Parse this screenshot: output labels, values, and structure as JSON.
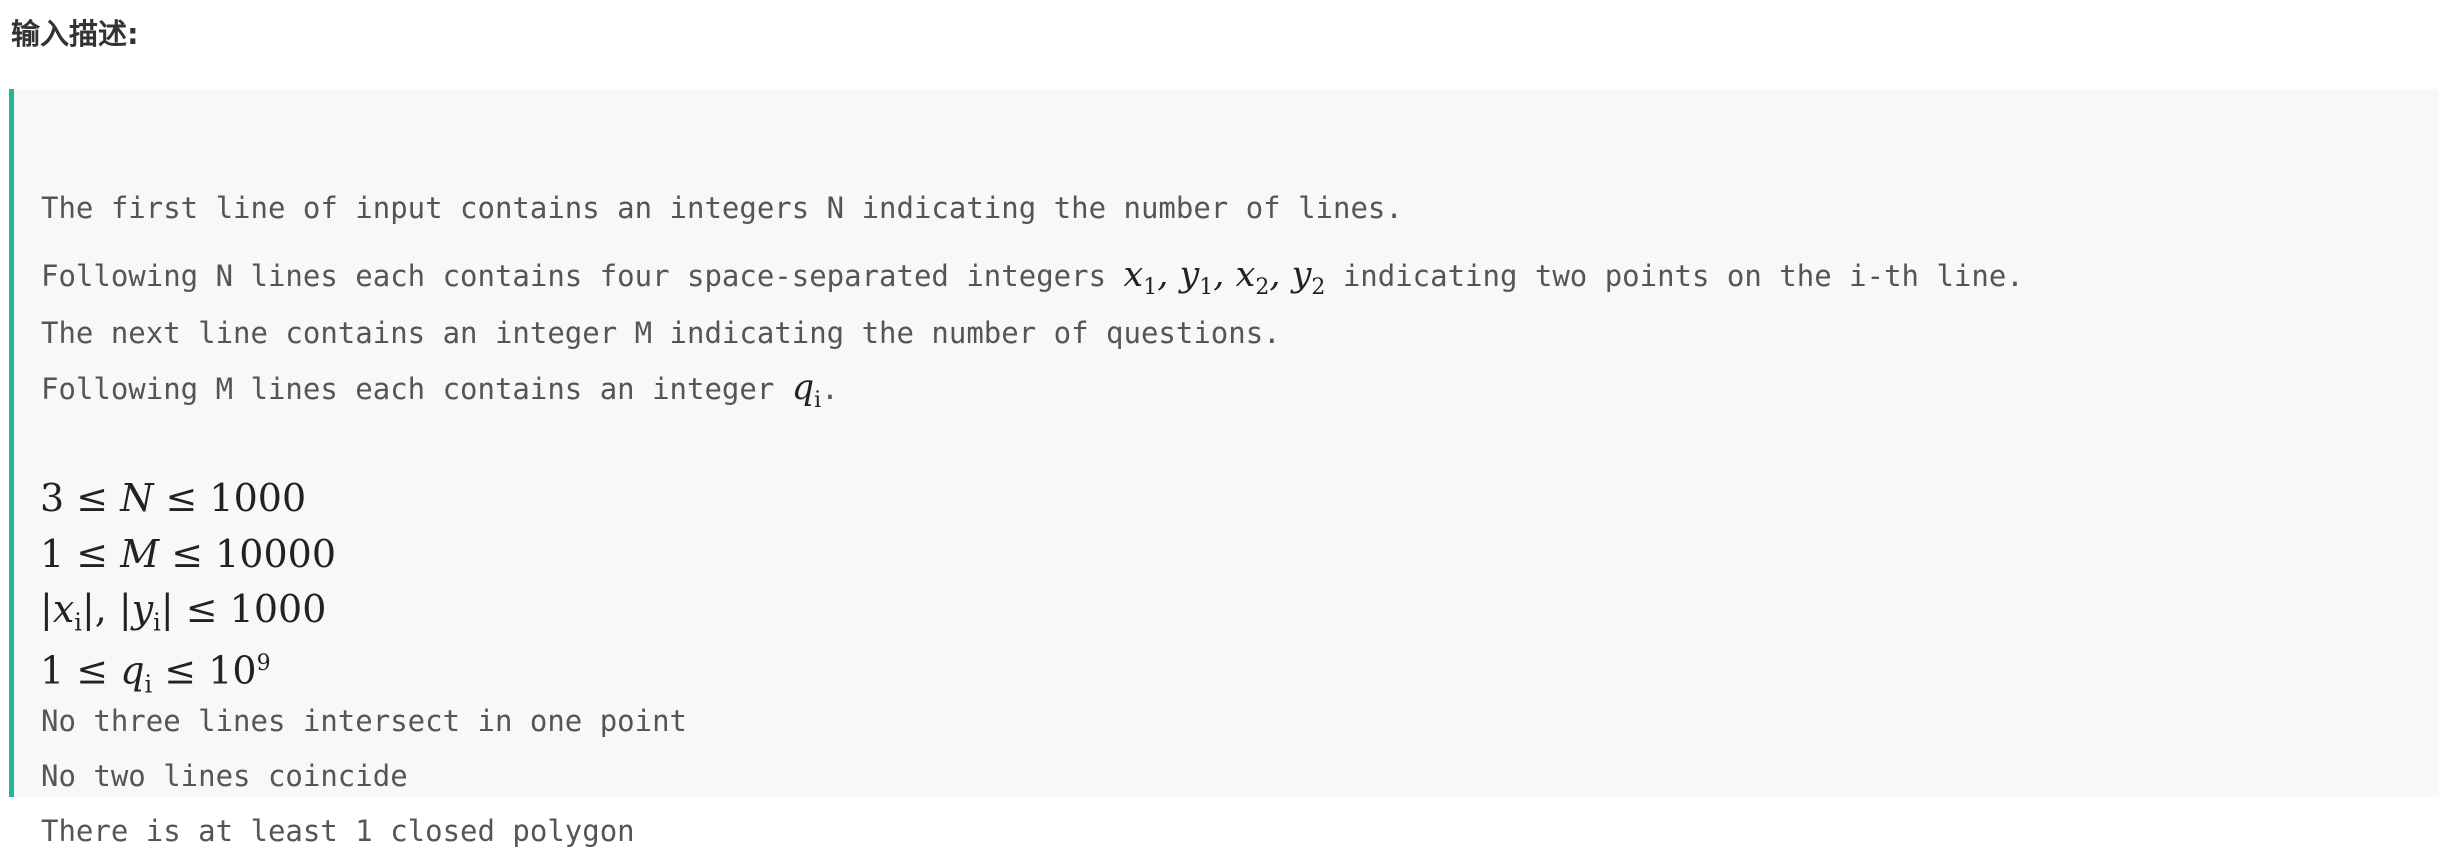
{
  "section": {
    "title": "输入描述:"
  },
  "input_description": {
    "line1": "The first line of input contains an integers N indicating the number of lines.",
    "line2_before": "Following N lines each contains four space-separated integers ",
    "line2_math": "x1, y1, x2, y2",
    "line2_after": " indicating two points on the i-th line.",
    "line3": "The next line contains an integer M indicating the number of questions.",
    "line4_before": "Following M lines each contains an integer ",
    "line4_math": "qi",
    "line4_after": "."
  },
  "constraints": {
    "n_range": "3 ≤ N ≤ 1000",
    "m_range": "1 ≤ M ≤ 10000",
    "coord_range": "|xi|, |yi| ≤ 1000",
    "q_range": "1 ≤ qi ≤ 10^9",
    "note1": "No three lines intersect in one point",
    "note2": "No two lines coincide",
    "note3": "There is at least 1 closed polygon"
  },
  "colors": {
    "accent_border": "#26b59c",
    "block_background": "#f7f8f8",
    "mono_text": "#555555",
    "title_text": "#333333"
  }
}
